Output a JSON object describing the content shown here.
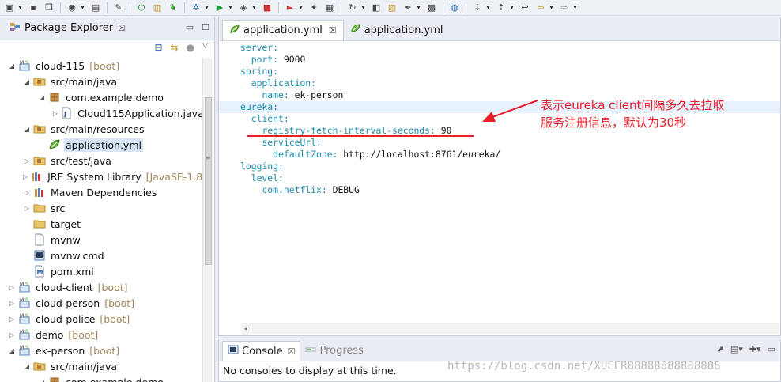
{
  "toolbar": {
    "icons": [
      "new-icon",
      "save-icon",
      "save-all-icon",
      "user-icon",
      "terminal-icon",
      "pin-icon",
      "power-icon",
      "folder-icon",
      "spring-icon",
      "debug-icon",
      "run-icon",
      "coverage-icon",
      "stop-icon",
      "launch-icon",
      "new-class-icon",
      "package-icon",
      "refresh-icon",
      "open-type-icon",
      "folder-open-icon",
      "wrench-icon",
      "briefcase-icon",
      "globe-icon",
      "next-annotation-icon",
      "prev-annotation-icon",
      "last-edit-icon",
      "back-icon",
      "forward-icon"
    ]
  },
  "package_explorer": {
    "title": "Package Explorer",
    "close_glyph": "☒",
    "tree": [
      {
        "indent": 0,
        "arrow": "open",
        "icon": "boot-project",
        "label": "cloud-115",
        "suffix": "[boot]"
      },
      {
        "indent": 1,
        "arrow": "open",
        "icon": "source-folder",
        "label": "src/main/java",
        "suffix": ""
      },
      {
        "indent": 2,
        "arrow": "open",
        "icon": "package",
        "label": "com.example.demo",
        "suffix": ""
      },
      {
        "indent": 3,
        "arrow": "closed",
        "icon": "java-file",
        "label": "Cloud115Application.java",
        "suffix": ""
      },
      {
        "indent": 1,
        "arrow": "open",
        "icon": "source-folder",
        "label": "src/main/resources",
        "suffix": ""
      },
      {
        "indent": 2,
        "arrow": "none",
        "icon": "yml-file",
        "label": "application.yml",
        "suffix": "",
        "selected": true
      },
      {
        "indent": 1,
        "arrow": "closed",
        "icon": "source-folder",
        "label": "src/test/java",
        "suffix": ""
      },
      {
        "indent": 1,
        "arrow": "closed",
        "icon": "library",
        "label": "JRE System Library",
        "suffix": "[JavaSE-1.8]"
      },
      {
        "indent": 1,
        "arrow": "closed",
        "icon": "library",
        "label": "Maven Dependencies",
        "suffix": ""
      },
      {
        "indent": 1,
        "arrow": "closed",
        "icon": "folder",
        "label": "src",
        "suffix": ""
      },
      {
        "indent": 1,
        "arrow": "none",
        "icon": "folder",
        "label": "target",
        "suffix": ""
      },
      {
        "indent": 1,
        "arrow": "none",
        "icon": "file",
        "label": "mvnw",
        "suffix": ""
      },
      {
        "indent": 1,
        "arrow": "none",
        "icon": "cmd-file",
        "label": "mvnw.cmd",
        "suffix": ""
      },
      {
        "indent": 1,
        "arrow": "none",
        "icon": "xml-file",
        "label": "pom.xml",
        "suffix": ""
      },
      {
        "indent": 0,
        "arrow": "closed",
        "icon": "boot-project",
        "label": "cloud-client",
        "suffix": "[boot]"
      },
      {
        "indent": 0,
        "arrow": "closed",
        "icon": "boot-project",
        "label": "cloud-person",
        "suffix": "[boot]"
      },
      {
        "indent": 0,
        "arrow": "closed",
        "icon": "boot-project",
        "label": "cloud-police",
        "suffix": "[boot]"
      },
      {
        "indent": 0,
        "arrow": "closed",
        "icon": "boot-project",
        "label": "demo",
        "suffix": "[boot]"
      },
      {
        "indent": 0,
        "arrow": "open",
        "icon": "boot-project",
        "label": "ek-person",
        "suffix": "[boot]"
      },
      {
        "indent": 1,
        "arrow": "open",
        "icon": "source-folder",
        "label": "src/main/java",
        "suffix": ""
      },
      {
        "indent": 2,
        "arrow": "open",
        "icon": "package",
        "label": "com.example.demo",
        "suffix": ""
      }
    ]
  },
  "editor": {
    "tabs": [
      {
        "label": "application.yml",
        "close": "☒",
        "active": true
      },
      {
        "label": "application.yml",
        "close": "",
        "active": false
      }
    ],
    "lines": [
      {
        "indent": "",
        "key": "server:",
        "value": "",
        "hl": false
      },
      {
        "indent": "  ",
        "key": "port:",
        "value": " 9000",
        "hl": false
      },
      {
        "indent": "",
        "key": "spring:",
        "value": "",
        "hl": false
      },
      {
        "indent": "  ",
        "key": "application:",
        "value": "",
        "hl": false
      },
      {
        "indent": "    ",
        "key": "name:",
        "value": " ek-person",
        "hl": false
      },
      {
        "indent": "",
        "key": "eureka:",
        "value": "",
        "hl": true
      },
      {
        "indent": "  ",
        "key": "client:",
        "value": "",
        "hl": false
      },
      {
        "indent": "    ",
        "key": "registry-fetch-interval-seconds:",
        "value": " 90",
        "hl": false
      },
      {
        "indent": "    ",
        "key": "serviceUrl:",
        "value": "",
        "hl": false
      },
      {
        "indent": "      ",
        "key": "defaultZone:",
        "value": " http://localhost:8761/eureka/",
        "hl": false
      },
      {
        "indent": "",
        "key": "logging:",
        "value": "",
        "hl": false
      },
      {
        "indent": "  ",
        "key": "level:",
        "value": "",
        "hl": false
      },
      {
        "indent": "    ",
        "key": "com.netflix:",
        "value": " DEBUG",
        "hl": false
      }
    ],
    "annotation": {
      "line1": "表示eureka client间隔多久去拉取",
      "line2": "服务注册信息，默认为30秒",
      "color": "#e8202a"
    }
  },
  "console": {
    "tabs": [
      {
        "label": "Console",
        "close": "☒",
        "active": true
      },
      {
        "label": "Progress",
        "close": "",
        "active": false
      }
    ],
    "message": "No consoles to display at this time."
  },
  "watermark": "https://blog.csdn.net/XUEER88888888888888"
}
